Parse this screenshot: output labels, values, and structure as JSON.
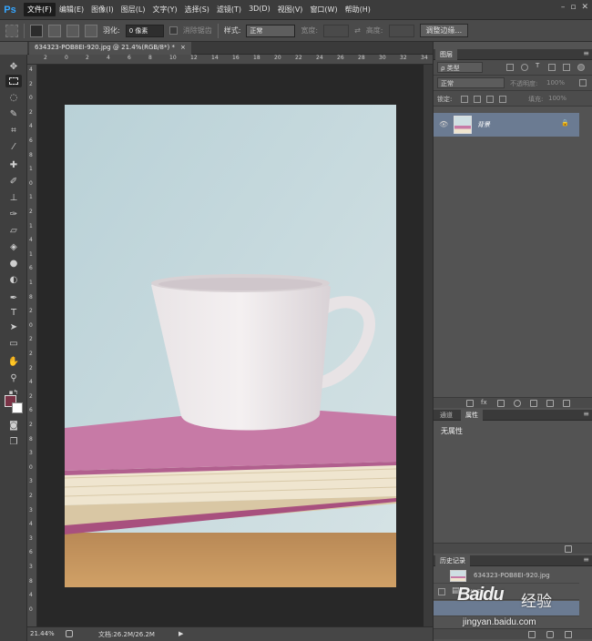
{
  "app": {
    "logo": "Ps"
  },
  "menu": {
    "items": [
      "文件(F)",
      "编辑(E)",
      "图像(I)",
      "图层(L)",
      "文字(Y)",
      "选择(S)",
      "滤镜(T)",
      "3D(D)",
      "视图(V)",
      "窗口(W)",
      "帮助(H)"
    ],
    "active_index": 0
  },
  "window_controls": {
    "minimize": "–",
    "restore": "▫",
    "close": "✕"
  },
  "options": {
    "feather_label": "羽化:",
    "feather_value": "0 像素",
    "antialias_label": "消除锯齿",
    "style_label": "样式:",
    "style_value": "正常",
    "width_label": "宽度:",
    "height_label": "高度:",
    "refine_button": "调整边缘..."
  },
  "document": {
    "tab_title": "634323-POB8EI-920.jpg @ 21.4%(RGB/8*) *",
    "tab_close": "×"
  },
  "ruler": {
    "top": [
      "2",
      "0",
      "2",
      "4",
      "6",
      "8",
      "10",
      "12",
      "14",
      "16",
      "18",
      "20",
      "22",
      "24",
      "26",
      "28",
      "30",
      "32",
      "34"
    ],
    "left": [
      "4",
      "2",
      "0",
      "2",
      "4",
      "6",
      "8",
      "1",
      "0",
      "1",
      "2",
      "1",
      "4",
      "1",
      "6",
      "1",
      "8",
      "2",
      "0",
      "2",
      "2",
      "2",
      "4",
      "2",
      "6",
      "2",
      "8",
      "3",
      "0",
      "3",
      "2",
      "3",
      "4",
      "3",
      "6",
      "3",
      "8",
      "4",
      "0"
    ]
  },
  "status": {
    "zoom": "21.44%",
    "doc_info": "文档:26.2M/26.2M",
    "arrow": "▶"
  },
  "layers_panel": {
    "tab": "图层",
    "kind_label": "ρ 类型",
    "blend_mode": "正常",
    "opacity_label": "不透明度:",
    "opacity_value": "100%",
    "lock_label": "锁定:",
    "fill_label": "填充:",
    "fill_value": "100%",
    "layer_name": "背景",
    "visibility_icon": "👁",
    "lock_icon": "🔒",
    "panel_menu": "≡"
  },
  "properties_panel": {
    "tabs": [
      "通道",
      "属性"
    ],
    "active_tab": 1,
    "content": "无属性"
  },
  "history_panel": {
    "tab": "历史记录",
    "items": [
      "634323-POB8EI-920.jpg",
      "打开"
    ]
  },
  "watermark": {
    "brand": "Baidu",
    "brand_cn": "经验",
    "url": "jingyan.baidu.com"
  },
  "colors": {
    "foreground": "#7a3346",
    "background": "#ffffff",
    "accent": "#35a6ff",
    "layer_selected": "#6b7b92"
  }
}
